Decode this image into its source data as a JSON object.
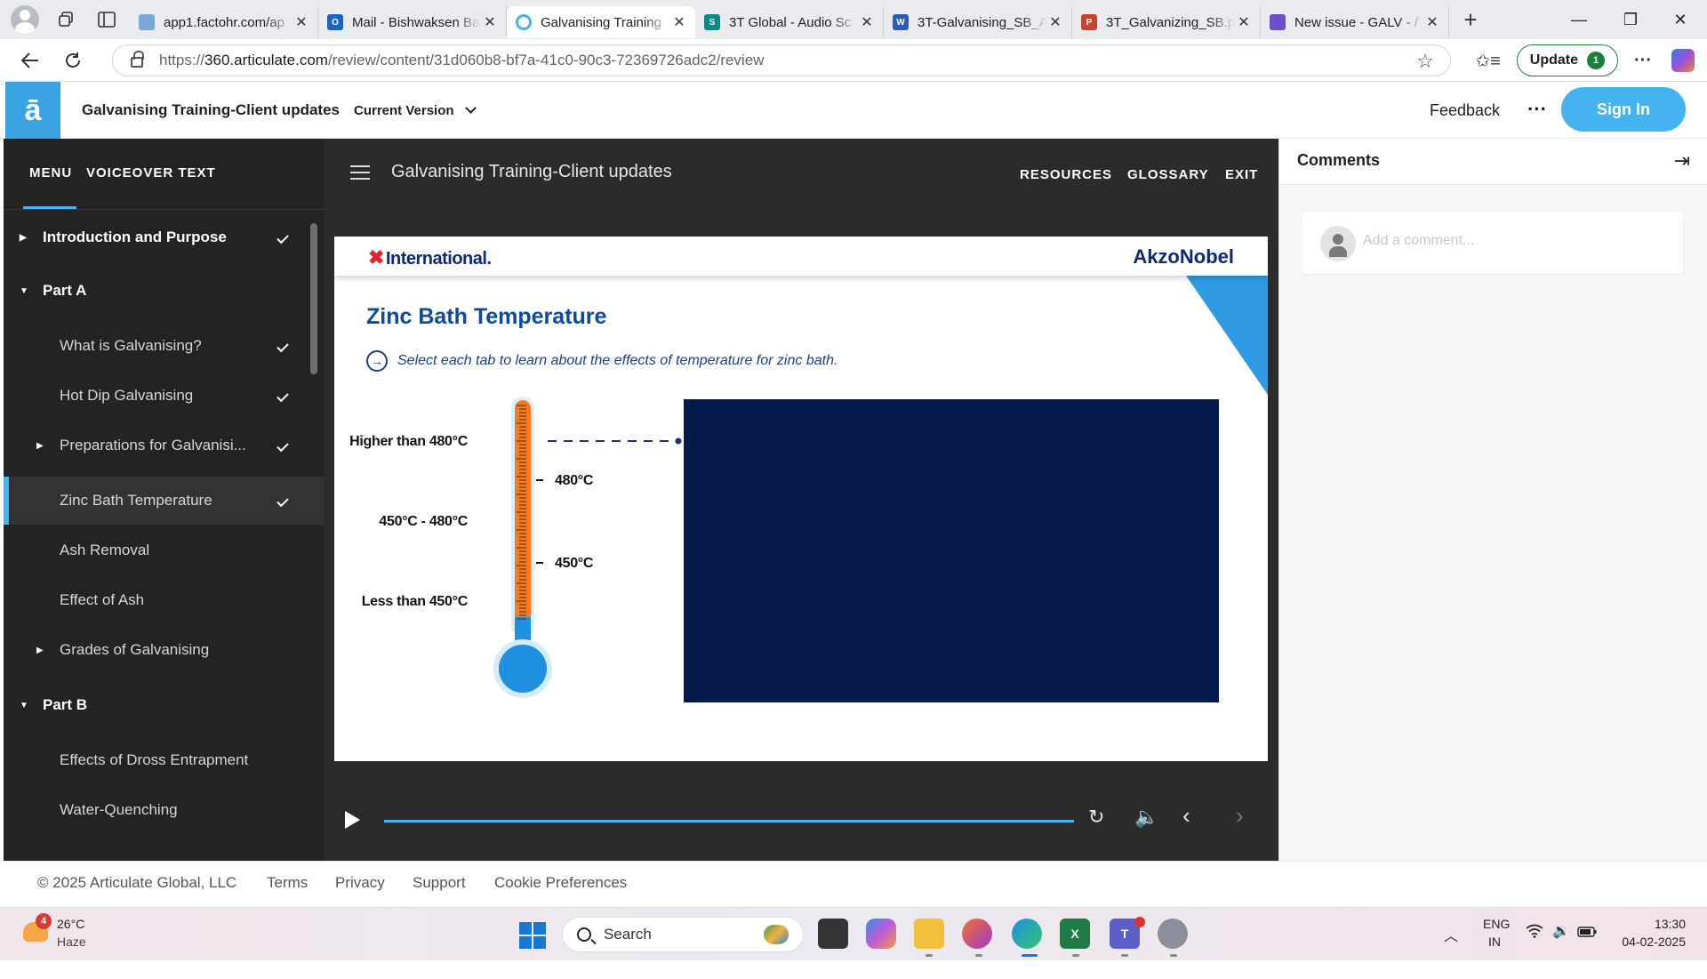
{
  "browser": {
    "tabs": [
      {
        "title": "app1.factohr.com/ap",
        "fav_color": "#7aa6d8",
        "fav_text": ""
      },
      {
        "title": "Mail - Bishwaksen Ba",
        "fav_color": "#1a64c4",
        "fav_text": "O"
      },
      {
        "title": "Galvanising Training",
        "fav_color": "#44b3ef",
        "fav_text": "",
        "active": true
      },
      {
        "title": "3T Global - Audio Sc",
        "fav_color": "#0b8a8a",
        "fav_text": "S"
      },
      {
        "title": "3T-Galvanising_SB_A",
        "fav_color": "#2b5cb8",
        "fav_text": "W"
      },
      {
        "title": "3T_Galvanizing_SB.p",
        "fav_color": "#c8432b",
        "fav_text": "P"
      },
      {
        "title": "New issue - GALV - /",
        "fav_color": "#6f4fc8",
        "fav_text": ""
      }
    ],
    "url_prefix": "https://",
    "url_host": "360.articulate.com",
    "url_path": "/review/content/31d060b8-bf7a-41c0-90c3-72369726adc2/review",
    "update_label": "Update",
    "update_badge": "1"
  },
  "app": {
    "logo": "ā",
    "title": "Galvanising Training-Client updates",
    "version_label": "Current Version",
    "feedback": "Feedback",
    "more": "···",
    "signin": "Sign In"
  },
  "sidebar": {
    "tabs": [
      "MENU",
      "VOICEOVER TEXT"
    ],
    "items": [
      {
        "label": "Introduction and Purpose",
        "type": "section",
        "caret": "right",
        "check": true
      },
      {
        "label": "Part A",
        "type": "section",
        "caret": "down",
        "check": false
      },
      {
        "label": "What is Galvanising?",
        "type": "item",
        "caret": "",
        "check": true
      },
      {
        "label": "Hot Dip Galvanising",
        "type": "item",
        "caret": "",
        "check": true
      },
      {
        "label": "Preparations for Galvanisi...",
        "type": "item",
        "caret": "right",
        "check": true
      },
      {
        "label": "Zinc Bath Temperature",
        "type": "item",
        "caret": "",
        "check": true,
        "selected": true
      },
      {
        "label": "Ash Removal",
        "type": "item",
        "caret": "",
        "check": false
      },
      {
        "label": "Effect of Ash",
        "type": "item",
        "caret": "",
        "check": false
      },
      {
        "label": "Grades of Galvanising",
        "type": "item",
        "caret": "right",
        "check": false
      },
      {
        "label": "Part B",
        "type": "section",
        "caret": "down",
        "check": false
      },
      {
        "label": "Effects of Dross Entrapment",
        "type": "item",
        "caret": "",
        "check": false
      },
      {
        "label": "Water-Quenching",
        "type": "item",
        "caret": "",
        "check": false
      }
    ]
  },
  "player": {
    "title": "Galvanising Training-Client updates",
    "links": [
      "RESOURCES",
      "GLOSSARY",
      "EXIT"
    ],
    "progress": 1.0
  },
  "slide": {
    "brand_left": "International.",
    "brand_right": "AkzoNobel",
    "heading": "Zinc Bath Temperature",
    "instruction": "Select each tab to learn about the effects of temperature for zinc bath.",
    "instruction_icon": "arrow-circle-icon",
    "labels": [
      "Higher than 480°C",
      "450°C - 480°C",
      "Less than 450°C"
    ],
    "ticks": [
      "480°C",
      "450°C"
    ],
    "colors": {
      "heading": "#0d4a9e",
      "thermo_fill": "#f47b20",
      "bulb": "#1f8fe0",
      "panel": "#041a4d",
      "accent": "#2f9be4"
    }
  },
  "comments": {
    "title": "Comments",
    "placeholder": "Add a comment..."
  },
  "footer": {
    "copyright": "© 2025 Articulate Global, LLC",
    "links": [
      "Terms",
      "Privacy",
      "Support",
      "Cookie Preferences"
    ]
  },
  "taskbar": {
    "weather_temp": "26°C",
    "weather_cond": "Haze",
    "weather_badge": "4",
    "search": "Search",
    "lang": "ENG",
    "region": "IN",
    "time": "13:30",
    "date": "04-02-2025"
  }
}
